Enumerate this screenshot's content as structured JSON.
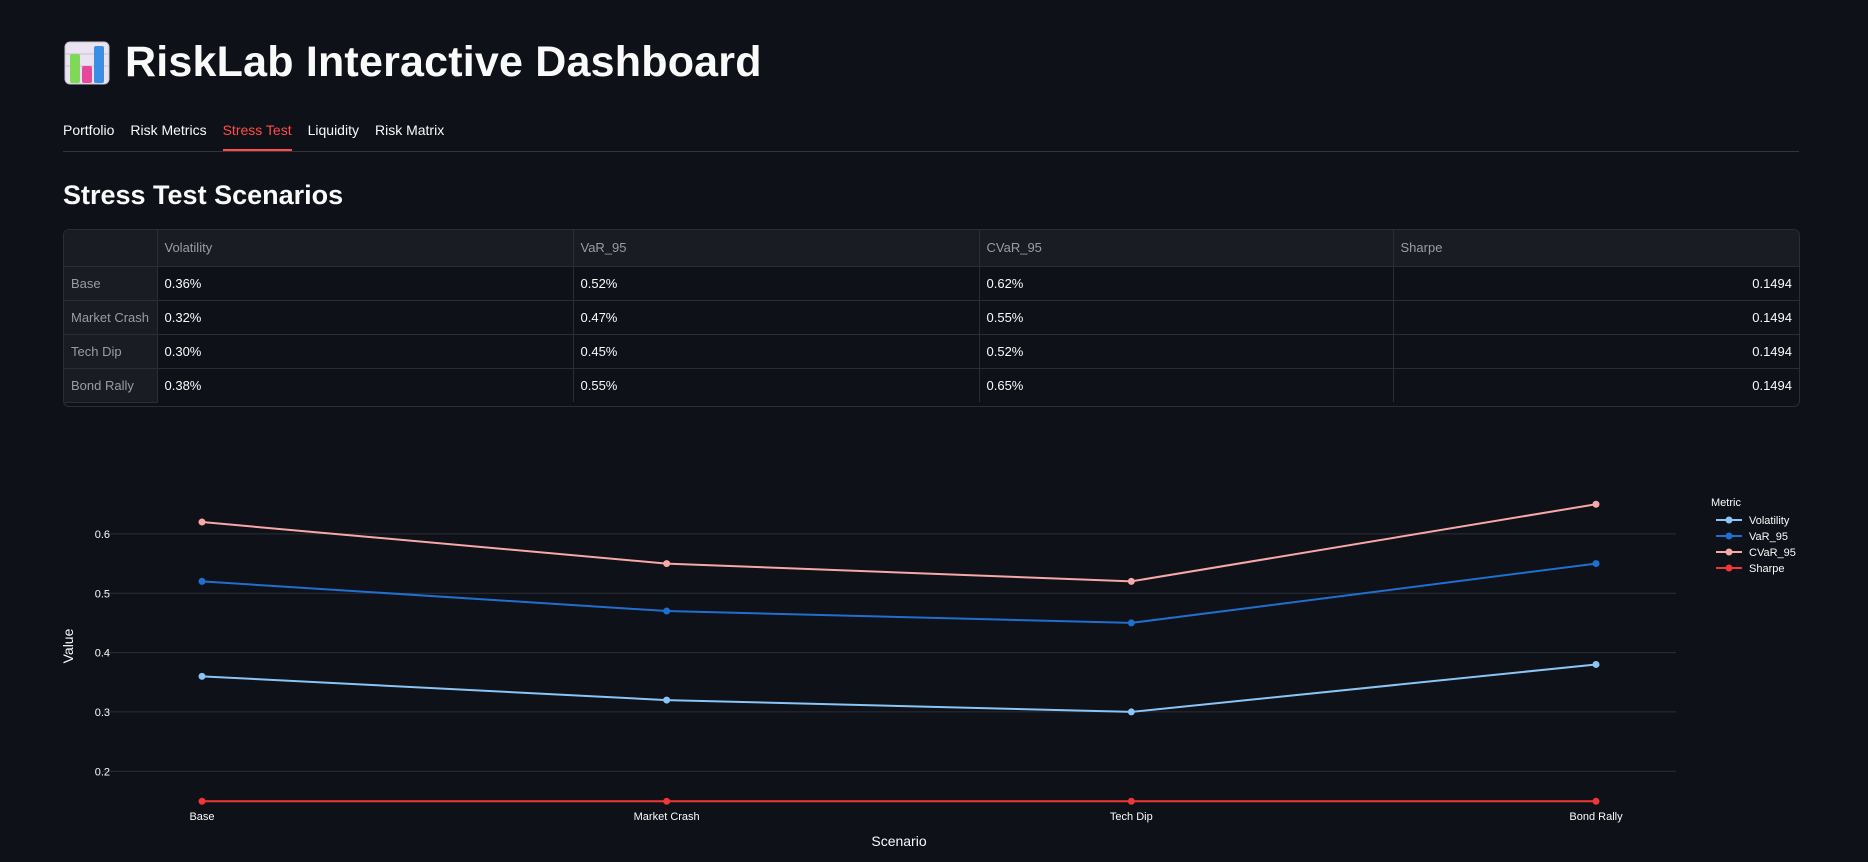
{
  "header": {
    "title": "RiskLab Interactive Dashboard",
    "icon": "bar-chart-icon"
  },
  "tabs": [
    {
      "label": "Portfolio",
      "active": false
    },
    {
      "label": "Risk Metrics",
      "active": false
    },
    {
      "label": "Stress Test",
      "active": true
    },
    {
      "label": "Liquidity",
      "active": false
    },
    {
      "label": "Risk Matrix",
      "active": false
    }
  ],
  "section_title": "Stress Test Scenarios",
  "table": {
    "columns": [
      "",
      "Volatility",
      "VaR_95",
      "CVaR_95",
      "Sharpe"
    ],
    "rows": [
      {
        "label": "Base",
        "volatility": "0.36%",
        "var95": "0.52%",
        "cvar95": "0.62%",
        "sharpe": "0.1494"
      },
      {
        "label": "Market Crash",
        "volatility": "0.32%",
        "var95": "0.47%",
        "cvar95": "0.55%",
        "sharpe": "0.1494"
      },
      {
        "label": "Tech Dip",
        "volatility": "0.30%",
        "var95": "0.45%",
        "cvar95": "0.52%",
        "sharpe": "0.1494"
      },
      {
        "label": "Bond Rally",
        "volatility": "0.38%",
        "var95": "0.55%",
        "cvar95": "0.65%",
        "sharpe": "0.1494"
      }
    ]
  },
  "chart_data": {
    "type": "line",
    "categories": [
      "Base",
      "Market Crash",
      "Tech Dip",
      "Bond Rally"
    ],
    "series": [
      {
        "name": "Volatility",
        "values": [
          0.36,
          0.32,
          0.3,
          0.38
        ],
        "color": "#8ac5f7"
      },
      {
        "name": "VaR_95",
        "values": [
          0.52,
          0.47,
          0.45,
          0.55
        ],
        "color": "#1f6fd1"
      },
      {
        "name": "CVaR_95",
        "values": [
          0.62,
          0.55,
          0.52,
          0.65
        ],
        "color": "#f7a8a8"
      },
      {
        "name": "Sharpe",
        "values": [
          0.1494,
          0.1494,
          0.1494,
          0.1494
        ],
        "color": "#f03737"
      }
    ],
    "xlabel": "Scenario",
    "ylabel": "Value",
    "legend_title": "Metric",
    "ylim": [
      0.128,
      0.674
    ],
    "yticks": [
      0.2,
      0.3,
      0.4,
      0.5,
      0.6
    ],
    "ytick_labels": [
      "0.2",
      "0.3",
      "0.4",
      "0.5",
      "0.6"
    ],
    "grid": true,
    "legend_placement": "top-right"
  }
}
